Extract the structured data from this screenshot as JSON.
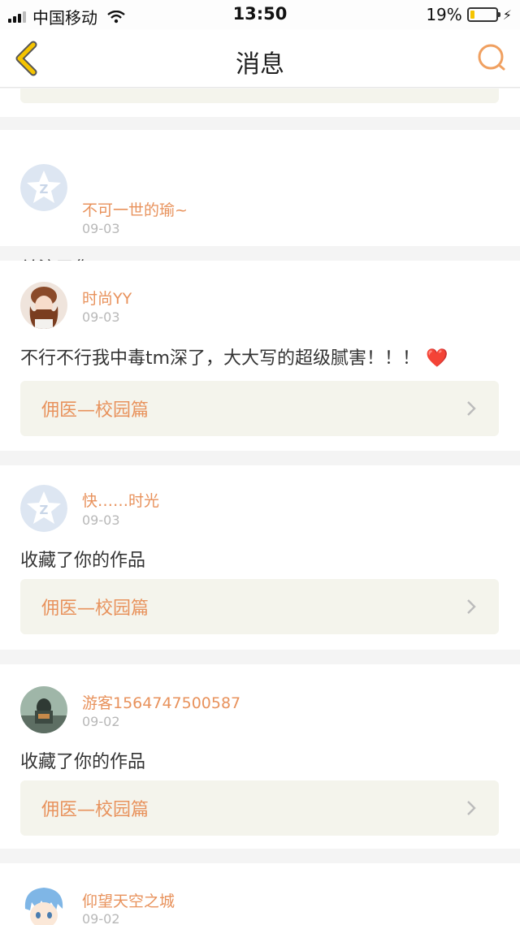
{
  "status_bar": {
    "carrier": "中国移动",
    "time": "13:50",
    "battery": "19%",
    "battery_level": 0.19
  },
  "nav": {
    "title": "消息",
    "back_icon": "chevron-left-icon",
    "search_icon": "search-icon"
  },
  "colors": {
    "accent": "#e8925c",
    "back_arrow": "#f5c400",
    "link_bg": "#f4f4ec"
  },
  "messages": [
    {
      "user": "不可一世的瑜~",
      "date": "09-03",
      "text": "关注了您",
      "avatar": "default-qq-avatar"
    },
    {
      "user": "时尚YY",
      "date": "09-03",
      "text": "不行不行我中毒tm深了，大大写的超级腻害！！！",
      "emoji": "❤️",
      "work": "佣医—校园篇",
      "avatar": "photo-avatar-girl"
    },
    {
      "user": "快……时光",
      "date": "09-03",
      "text": "收藏了你的作品",
      "work": "佣医—校园篇",
      "avatar": "default-qq-avatar"
    },
    {
      "user": "游客1564747500587",
      "date": "09-02",
      "text": "收藏了你的作品",
      "work": "佣医—校园篇",
      "avatar": "photo-avatar-figure"
    },
    {
      "user": "仰望天空之城",
      "date": "09-02",
      "avatar": "anime-avatar-blue-hair"
    }
  ]
}
